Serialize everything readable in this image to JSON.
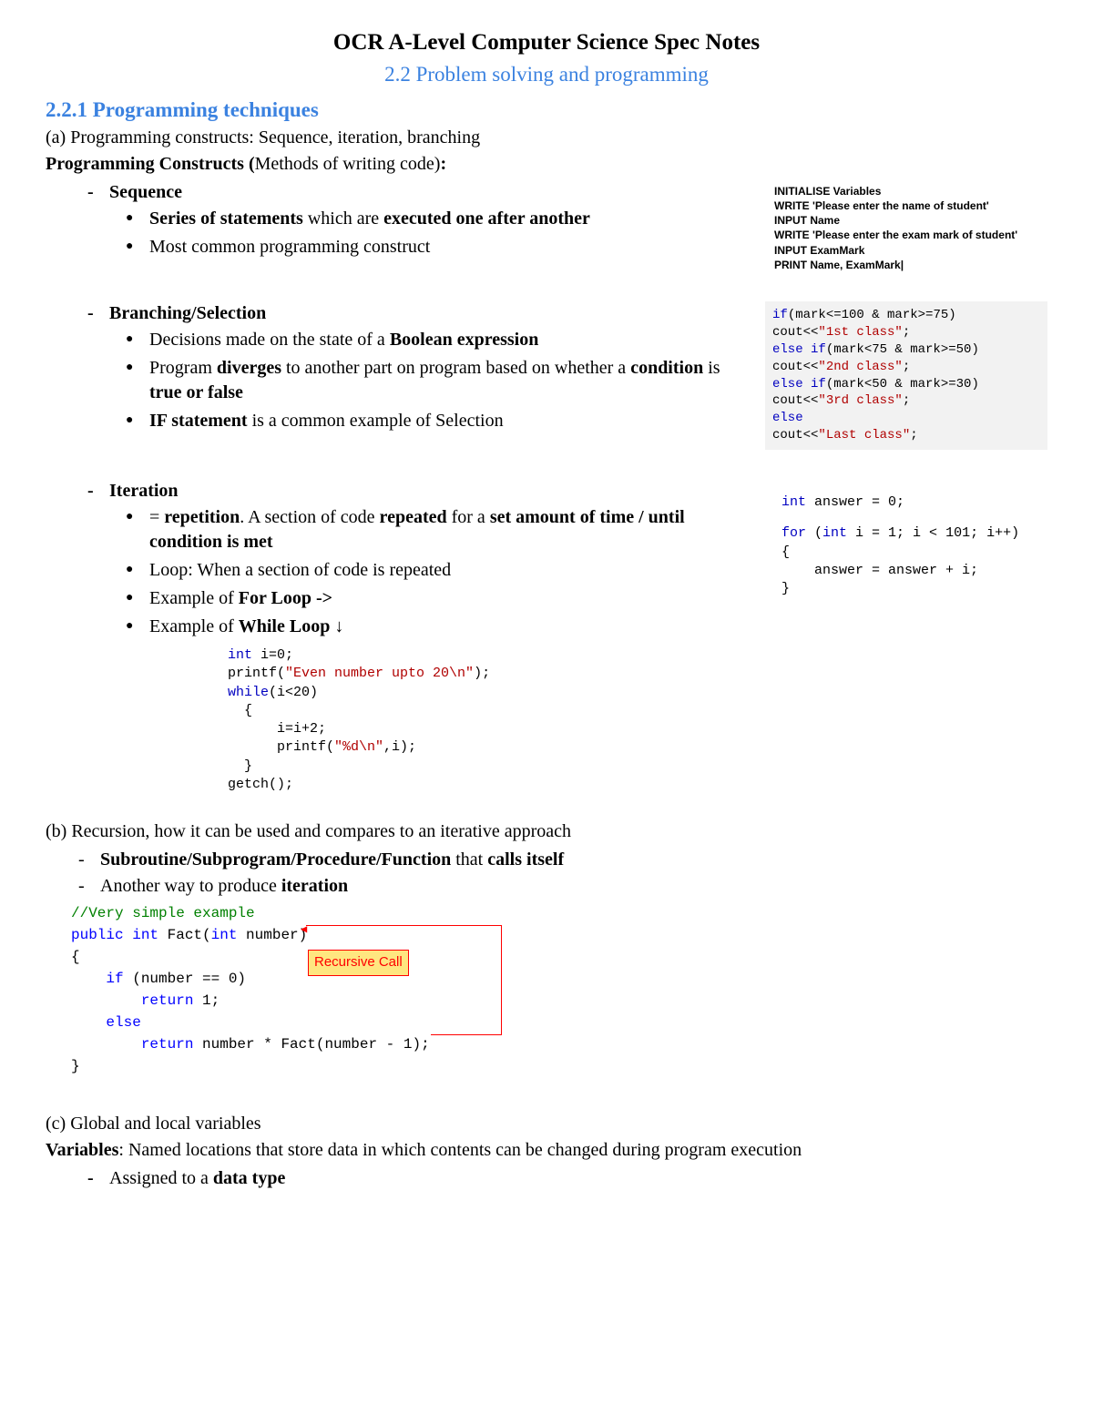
{
  "header": {
    "main": "OCR A-Level Computer Science Spec Notes",
    "sub": "2.2 Problem solving and programming"
  },
  "sec221": {
    "heading": "2.2.1 Programming techniques",
    "a_intro": "(a) Programming constructs: Sequence, iteration, branching",
    "constructs_prefix": "Programming Constructs (",
    "constructs_mid": "Methods of writing code)",
    "constructs_suffix": ":",
    "sequence": {
      "title": "Sequence",
      "b1_pre": "Series of statements",
      "b1_mid": " which are ",
      "b1_post": "executed one after another",
      "b2": "Most common programming construct",
      "code": {
        "l1": "INITIALISE Variables",
        "l2": "WRITE 'Please enter the name of student'",
        "l3": "INPUT Name",
        "l4": "WRITE 'Please enter the exam mark of student'",
        "l5": "INPUT ExamMark",
        "l6": "PRINT Name, ExamMark|"
      }
    },
    "branching": {
      "title": "Branching/Selection",
      "b1_pre": "Decisions made on the state of a ",
      "b1_post": "Boolean expression",
      "b2_a": "Program ",
      "b2_b": "diverges",
      "b2_c": " to another part on program based on whether a ",
      "b2_d": "condition",
      "b2_e": " is ",
      "b2_f": "true or false",
      "b3_a": "IF statement",
      "b3_b": " is a common example of Selection",
      "code": {
        "l1a": "if",
        "l1b": "(mark<=100 & mark>=75)",
        "l2a": "cout<<",
        "l2b": "\"1st class\"",
        "l2c": ";",
        "l3a": "else if",
        "l3b": "(mark<75 & mark>=50)",
        "l4a": "cout<<",
        "l4b": "\"2nd class\"",
        "l4c": ";",
        "l5a": "else if",
        "l5b": "(mark<50 & mark>=30)",
        "l6a": "cout<<",
        "l6b": "\"3rd class\"",
        "l6c": ";",
        "l7": "else",
        "l8a": "cout<<",
        "l8b": "\"Last class\"",
        "l8c": ";"
      }
    },
    "iteration": {
      "title": "Iteration",
      "b1_a": "= ",
      "b1_b": "repetition",
      "b1_c": ". A section of code ",
      "b1_d": "repeated",
      "b1_e": " for a ",
      "b1_f": "set amount of time / until condition is met",
      "b2": "Loop: When a section of code is repeated",
      "b3_a": "Example of ",
      "b3_b": "For Loop ->",
      "b4_a": "Example of ",
      "b4_b": "While Loop",
      "b4_c": " ↓",
      "forcode": {
        "l1a": "int",
        "l1b": " answer = 0;",
        "l2a": "for",
        "l2b": " (",
        "l2c": "int",
        "l2d": " i = 1; i < 101; i++)",
        "l3": "{",
        "l4": "    answer = answer + i;",
        "l5": "}"
      },
      "whilecode": {
        "l1a": "int",
        "l1b": " i=0;",
        "l2a": "printf(",
        "l2b": "\"Even number upto 20\\n\"",
        "l2c": ");",
        "l3a": "while",
        "l3b": "(i<20)",
        "l4": "  {",
        "l5": "      i=i+2;",
        "l6a": "      printf(",
        "l6b": "\"%d\\n\"",
        "l6c": ",i);",
        "l7": "  }",
        "l8": "getch();"
      }
    },
    "b_intro": "(b) Recursion, how it can be used and compares to an iterative approach",
    "recursion": {
      "b1_a": "Subroutine/Subprogram/Procedure/Function",
      "b1_b": " that ",
      "b1_c": "calls itself",
      "b2_a": "Another way to produce ",
      "b2_b": "iteration",
      "tag": "Recursive Call",
      "code": {
        "l1": "//Very simple example",
        "l2a": "public",
        "l2b": " int",
        "l2c": " Fact(",
        "l2d": "int",
        "l2e": " number)",
        "l3": "{",
        "l4a": "    if",
        "l4b": " (number == 0)",
        "l5a": "        return",
        "l5b": " 1;",
        "l6": "    else",
        "l7a": "        return",
        "l7b": " number * Fact(number - 1);",
        "l8": "}"
      }
    },
    "c_intro": "(c) Global and local variables",
    "variables": {
      "prefix": "Variables",
      "rest": ": Named locations that store data in which contents can be changed during program execution",
      "b1_a": "Assigned to a ",
      "b1_b": "data type"
    }
  }
}
